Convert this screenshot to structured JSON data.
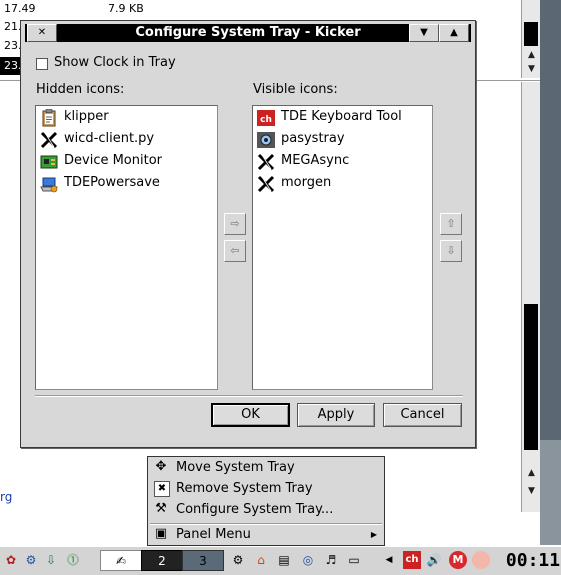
{
  "background": {
    "rows": [
      {
        "col1": "17.49",
        "col2": "7.9 KB"
      },
      {
        "col1": "21.",
        "col2": ""
      },
      {
        "col1": "23.",
        "col2": ""
      },
      {
        "col1": "23.",
        "col2": ""
      }
    ],
    "link_text": "rg"
  },
  "dialog": {
    "title": "Configure System Tray - Kicker",
    "close_glyph": "✕",
    "shade_glyph": "▼",
    "max_glyph": "▲",
    "show_clock_label": "Show Clock in Tray",
    "show_clock_checked": false,
    "hidden_label": "Hidden icons:",
    "visible_label": "Visible icons:",
    "hidden_icons": [
      {
        "label": "klipper",
        "icon": "clipboard-icon"
      },
      {
        "label": "wicd-client.py",
        "icon": "x-icon"
      },
      {
        "label": "Device Monitor",
        "icon": "device-board-icon"
      },
      {
        "label": "TDEPowersave",
        "icon": "laptop-power-icon"
      }
    ],
    "visible_icons": [
      {
        "label": "TDE Keyboard Tool",
        "icon": "keyboard-layout-icon"
      },
      {
        "label": "pasystray",
        "icon": "speaker-icon"
      },
      {
        "label": "MEGAsync",
        "icon": "x-icon"
      },
      {
        "label": "morgen",
        "icon": "x-icon"
      }
    ],
    "move_right_glyph": "⇨",
    "move_left_glyph": "⇦",
    "move_up_glyph": "⇧",
    "move_down_glyph": "⇩",
    "buttons": {
      "ok": "OK",
      "apply": "Apply",
      "cancel": "Cancel"
    }
  },
  "menu": {
    "items": [
      {
        "label": "Move System Tray",
        "icon": "move-icon",
        "glyph": "✥"
      },
      {
        "label": "Remove System Tray",
        "icon": "remove-icon",
        "glyph": "✖"
      },
      {
        "label": "Configure System Tray...",
        "icon": "tools-icon",
        "glyph": "⚒"
      },
      {
        "label": "Panel Menu",
        "icon": "panel-icon",
        "glyph": "▣"
      }
    ]
  },
  "taskbar": {
    "desktops": [
      "2",
      "3"
    ],
    "clock": "00:11",
    "tray_badge": "ch",
    "mega_badge": "M"
  },
  "colors": {
    "title_bg": "#000000",
    "dialog_bg": "#d8d8d8",
    "tde_red": "#cc2222",
    "mega_red": "#d9272e"
  }
}
